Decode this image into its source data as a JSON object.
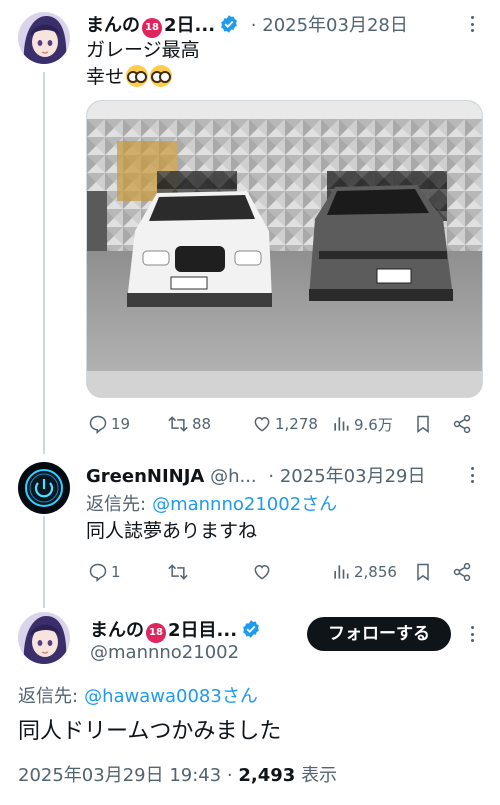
{
  "tweet1": {
    "author_name": "まんの",
    "author_badge": "18",
    "author_suffix": "2日...",
    "dot": "·",
    "timestamp": "2025年03月28日",
    "text_line1": "ガレージ最高",
    "text_line2": "幸せ",
    "emoji": "nerd-face-emoji",
    "stats": {
      "replies": "19",
      "retweets": "88",
      "likes": "1,278",
      "views": "9.6万"
    }
  },
  "tweet2": {
    "author_name": "GreenNINJA",
    "handle": "@h...",
    "dot": "·",
    "timestamp": "2025年03月29日",
    "reply_prefix": "返信先:",
    "reply_to": "@mannno21002さん",
    "text": "同人誌夢ありますね",
    "stats": {
      "replies": "1",
      "retweets": "",
      "likes": "",
      "views": "2,856"
    }
  },
  "tweet3": {
    "author_name": "まんの",
    "author_badge": "18",
    "author_suffix": "2日目...",
    "handle": "@mannno21002",
    "follow_label": "フォローする",
    "reply_prefix": "返信先:",
    "reply_to": "@hawawa0083さん",
    "text": "同人ドリームつかみました",
    "meta_time": "2025年03月29日 19:43 ·",
    "meta_views": "2,493",
    "meta_views_label": "表示"
  },
  "colors": {
    "accent": "#1d9bf0",
    "text": "#0f1419",
    "muted": "#536471",
    "verified": "#1d9bf0",
    "follow_bg": "#0f1419"
  }
}
